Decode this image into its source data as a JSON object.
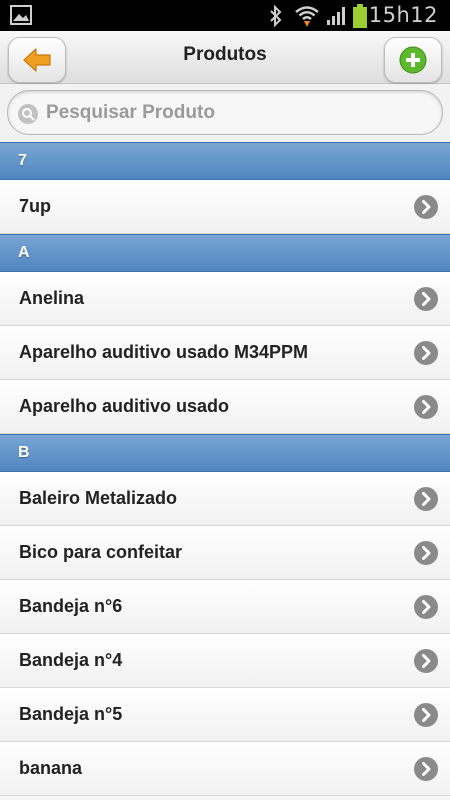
{
  "status_bar": {
    "time": "15h12",
    "icons": [
      "gallery-icon",
      "bluetooth-icon",
      "wifi-icon",
      "signal-icon",
      "battery-icon"
    ]
  },
  "header": {
    "title": "Produtos",
    "back_icon": "arrow-left-icon",
    "add_icon": "plus-circle-icon"
  },
  "search": {
    "placeholder": "Pesquisar Produto",
    "value": ""
  },
  "colors": {
    "divider": "#5b8fc7",
    "back_arrow": "#f0a020",
    "add_button": "#5cb82c",
    "chevron": "#8a8a8a"
  },
  "list": {
    "sections": [
      {
        "header": "7",
        "items": [
          "7up"
        ]
      },
      {
        "header": "A",
        "items": [
          "Anelina",
          "Aparelho auditivo usado M34PPM",
          "Aparelho auditivo usado"
        ]
      },
      {
        "header": "B",
        "items": [
          "Baleiro Metalizado",
          "Bico para confeitar",
          "Bandeja n°6",
          "Bandeja n°4",
          "Bandeja n°5",
          "banana"
        ]
      }
    ]
  }
}
